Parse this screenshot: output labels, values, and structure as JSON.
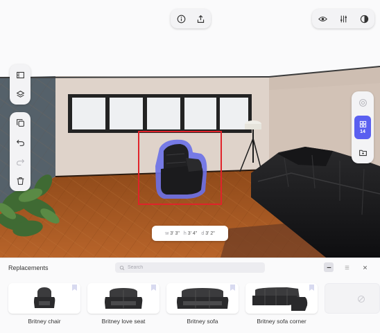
{
  "toolbar_top_center": {
    "icons": [
      "info-icon",
      "share-icon"
    ]
  },
  "toolbar_top_right": {
    "icons": [
      "eye-icon",
      "adjust-icon",
      "contrast-icon"
    ]
  },
  "toolbar_left": {
    "icons": [
      "floorplan-icon",
      "layers-icon",
      "duplicate-icon",
      "undo-icon",
      "redo-icon",
      "trash-icon"
    ]
  },
  "toolbar_right": {
    "catalog_count": "14",
    "icons": [
      "camera-icon",
      "grid-icon",
      "folder-icon"
    ]
  },
  "selection": {
    "dimensions": [
      {
        "key": "w",
        "value": "3' 3\""
      },
      {
        "key": "h",
        "value": "3' 4\""
      },
      {
        "key": "d",
        "value": "3' 2\""
      }
    ],
    "highlight_color": "#e0232a",
    "glow_color": "#6a70e8"
  },
  "panel": {
    "title": "Replacements",
    "search_placeholder": "Search",
    "items": [
      {
        "label": "Britney chair"
      },
      {
        "label": "Britney love seat"
      },
      {
        "label": "Britney sofa"
      },
      {
        "label": "Britney sofa corner"
      }
    ]
  },
  "colors": {
    "accent": "#5a5ff0",
    "panel_bg": "#fafafb",
    "wall": "#d9cfc6",
    "floor": "#a3561f"
  }
}
